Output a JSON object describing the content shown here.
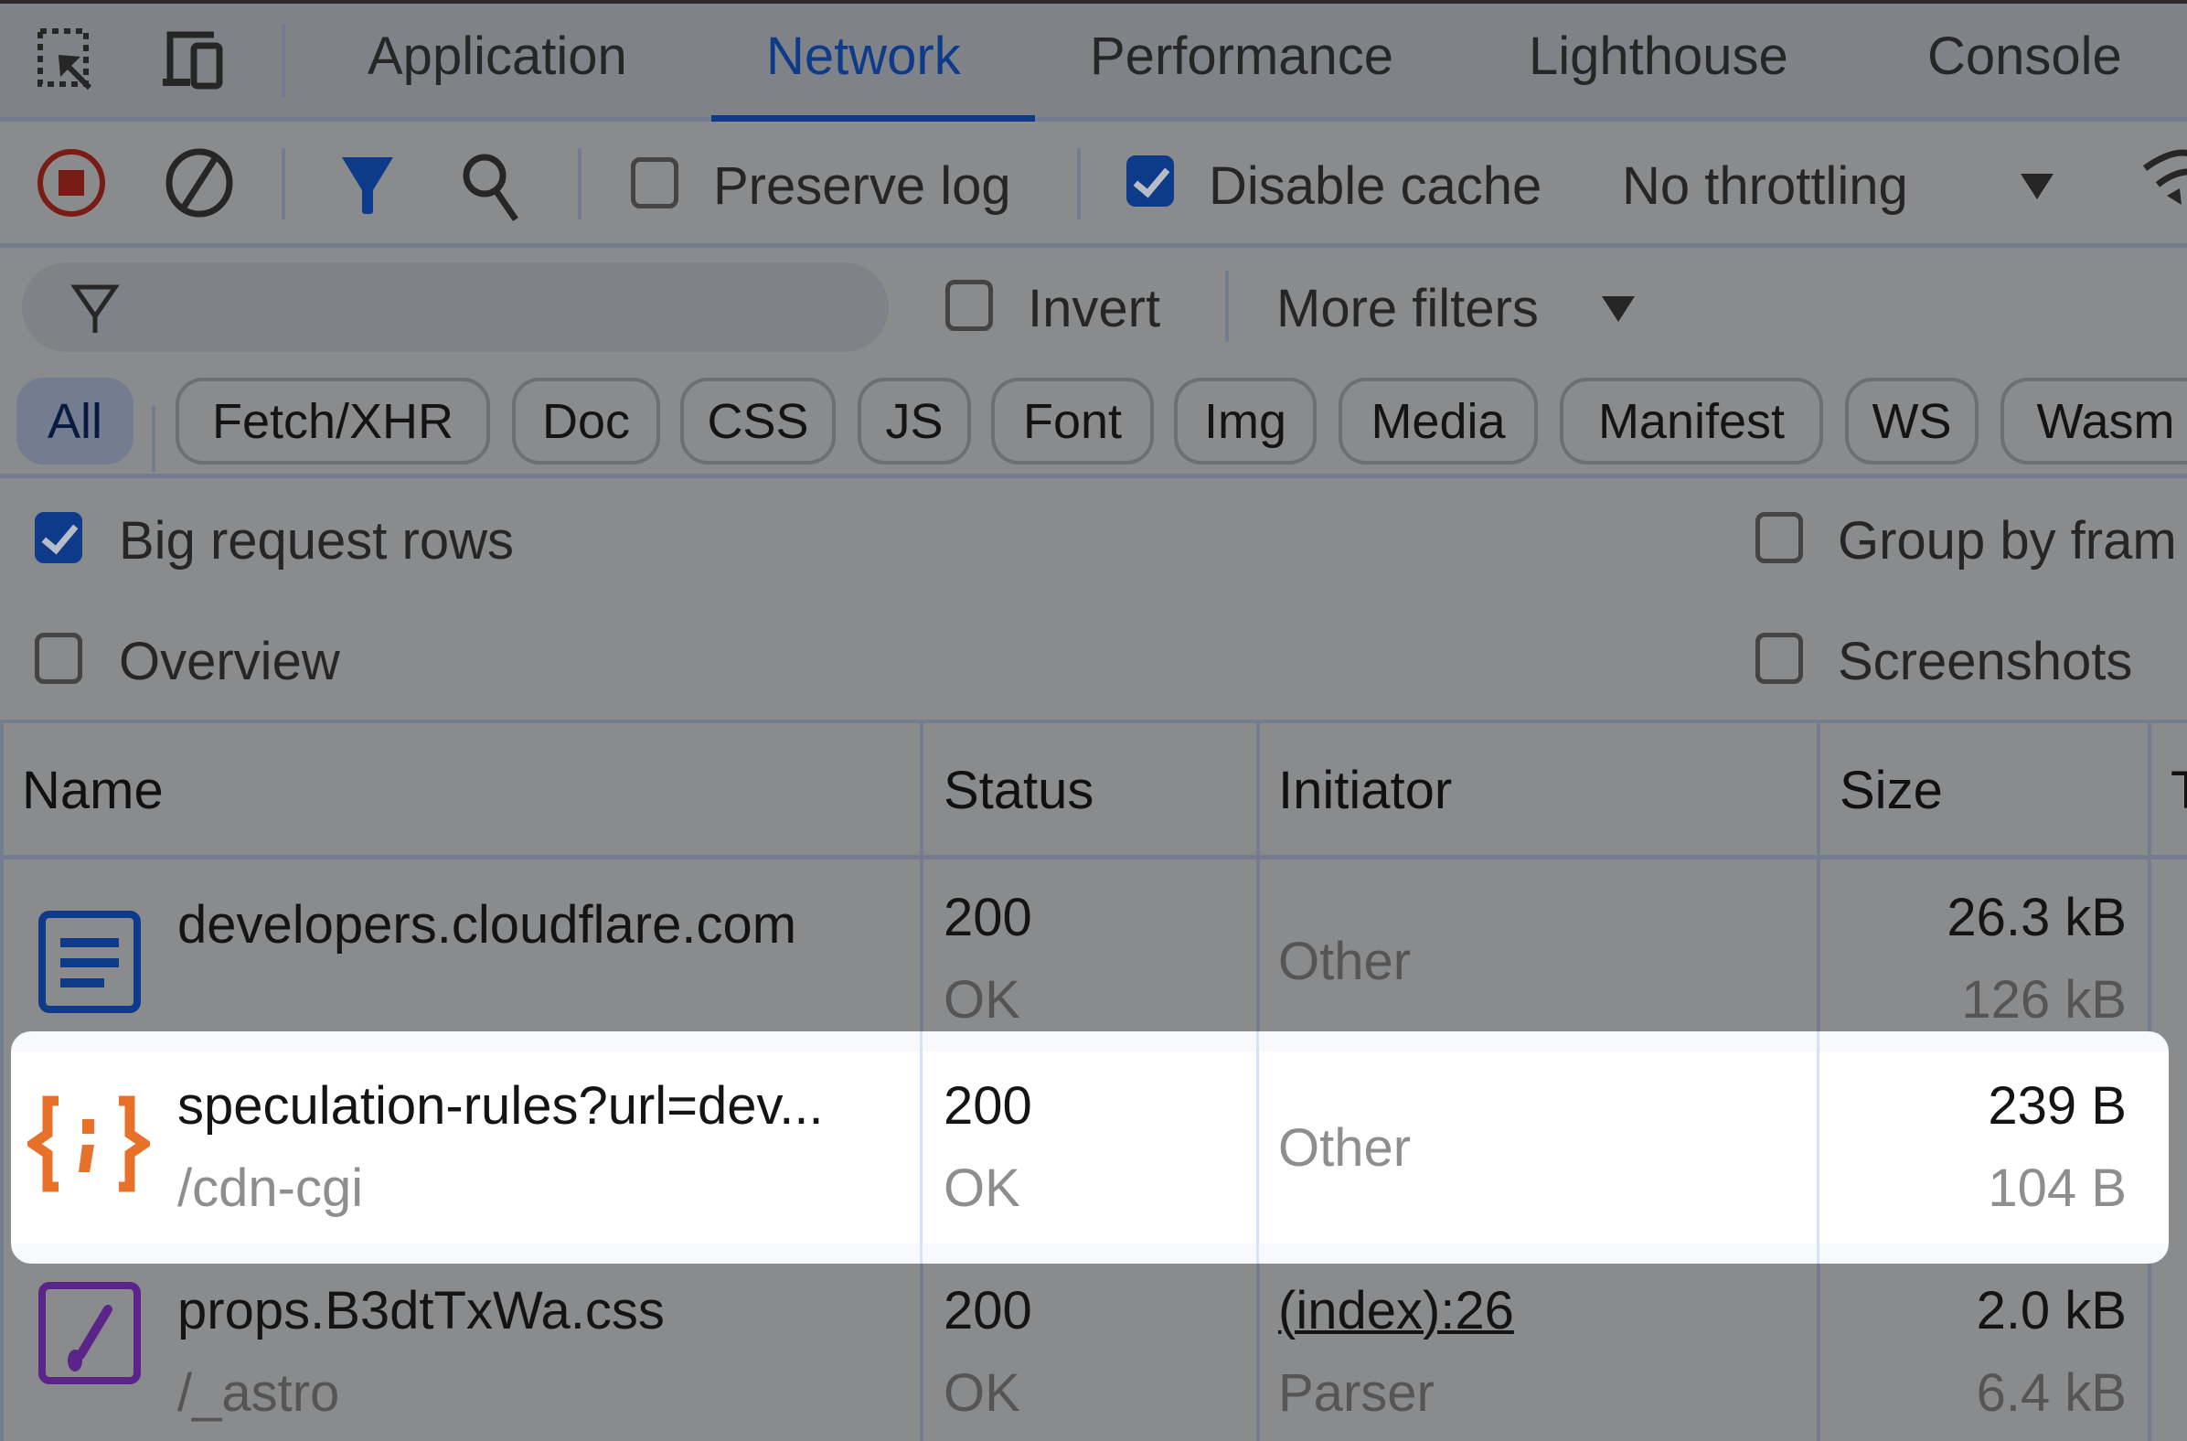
{
  "tabs": [
    {
      "label": "Application",
      "active": false
    },
    {
      "label": "Network",
      "active": true
    },
    {
      "label": "Performance",
      "active": false
    },
    {
      "label": "Lighthouse",
      "active": false
    },
    {
      "label": "Console",
      "active": false
    }
  ],
  "toolbar": {
    "record_icon": "stop-recording-icon",
    "clear_icon": "clear-icon",
    "filter_icon": "filter-icon",
    "search_icon": "search-icon",
    "preserve_log": {
      "label": "Preserve log",
      "checked": false
    },
    "disable_cache": {
      "label": "Disable cache",
      "checked": true
    },
    "throttling": {
      "value": "No throttling"
    },
    "network_conditions_icon": "wifi-icon"
  },
  "filter": {
    "placeholder": "",
    "value": "",
    "invert": {
      "label": "Invert",
      "checked": false
    },
    "more_filters": "More filters"
  },
  "type_filters": [
    "All",
    "Fetch/XHR",
    "Doc",
    "CSS",
    "JS",
    "Font",
    "Img",
    "Media",
    "Manifest",
    "WS",
    "Wasm"
  ],
  "active_type_filter": "All",
  "settings": {
    "big_request_rows": {
      "label": "Big request rows",
      "checked": true
    },
    "overview": {
      "label": "Overview",
      "checked": false
    },
    "group_by_frame": {
      "label": "Group by fram",
      "checked": false
    },
    "screenshots": {
      "label": "Screenshots",
      "checked": false
    }
  },
  "table": {
    "columns": [
      "Name",
      "Status",
      "Initiator",
      "Size",
      "T"
    ],
    "rows": [
      {
        "icon": "document-icon",
        "icon_color": "#0e3a8a",
        "name": "developers.cloudflare.com",
        "path": "",
        "status_code": "200",
        "status_text": "OK",
        "initiator": "Other",
        "initiator_sub": "",
        "size_transferred": "26.3 kB",
        "size_resource": "126 kB",
        "highlighted": false
      },
      {
        "icon": "script-icon",
        "icon_color": "#e8712a",
        "name": "speculation-rules?url=dev...",
        "path": "/cdn-cgi",
        "status_code": "200",
        "status_text": "OK",
        "initiator": "Other",
        "initiator_sub": "",
        "size_transferred": "239 B",
        "size_resource": "104 B",
        "highlighted": true
      },
      {
        "icon": "stylesheet-icon",
        "icon_color": "#5b2489",
        "name": "props.B3dtTxWa.css",
        "path": "/_astro",
        "status_code": "200",
        "status_text": "OK",
        "initiator": "(index):26",
        "initiator_sub": "Parser",
        "size_transferred": "2.0 kB",
        "size_resource": "6.4 kB",
        "highlighted": false
      }
    ]
  },
  "colors": {
    "accent": "#0e3a8a",
    "record_red": "#7a1c16",
    "overlay_bg": "#8a8b8c"
  }
}
